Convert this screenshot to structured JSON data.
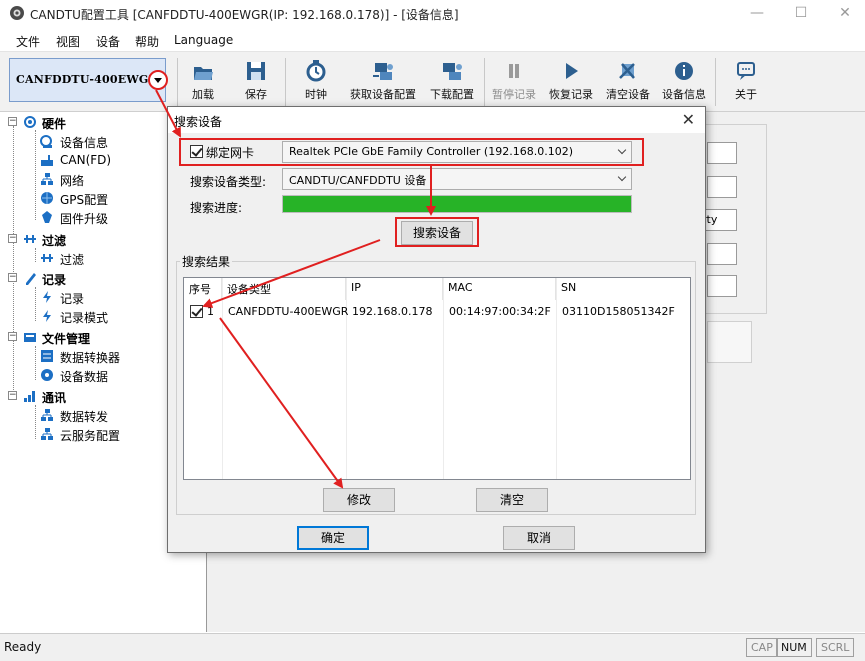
{
  "window": {
    "title": "CANDTU配置工具 [CANFDDTU-400EWGR(IP: 192.168.0.178)] - [设备信息]",
    "controls": [
      "—",
      "☐",
      "✕"
    ]
  },
  "menu": [
    "文件",
    "视图",
    "设备",
    "帮助",
    "Language"
  ],
  "toolbar": {
    "device_combo": "CANFDDTU-400EWGR",
    "buttons": [
      {
        "label": "加载",
        "icon": "load-icon"
      },
      {
        "label": "保存",
        "icon": "save-icon"
      },
      {
        "label": "时钟",
        "icon": "clock-icon"
      },
      {
        "label": "获取设备配置",
        "icon": "get-config-icon"
      },
      {
        "label": "下载配置",
        "icon": "download-config-icon"
      },
      {
        "label": "暂停记录",
        "icon": "pause-icon",
        "disabled": true
      },
      {
        "label": "恢复记录",
        "icon": "play-icon"
      },
      {
        "label": "清空设备",
        "icon": "clear-device-icon"
      },
      {
        "label": "设备信息",
        "icon": "info-icon"
      },
      {
        "label": "关于",
        "icon": "about-icon"
      }
    ]
  },
  "tree": {
    "groups": [
      {
        "label": "硬件",
        "icon": "hardware-icon",
        "children": [
          {
            "label": "设备信息",
            "icon": "device-info-icon"
          },
          {
            "label": "CAN(FD)",
            "icon": "can-icon"
          },
          {
            "label": "网络",
            "icon": "network-icon"
          },
          {
            "label": "GPS配置",
            "icon": "gps-icon"
          },
          {
            "label": "固件升级",
            "icon": "firmware-icon"
          }
        ]
      },
      {
        "label": "过滤",
        "icon": "filter-icon",
        "children": [
          {
            "label": "过滤",
            "icon": "filter-icon"
          }
        ]
      },
      {
        "label": "记录",
        "icon": "record-icon",
        "children": [
          {
            "label": "记录",
            "icon": "record-icon"
          },
          {
            "label": "记录模式",
            "icon": "record-mode-icon"
          }
        ]
      },
      {
        "label": "文件管理",
        "icon": "file-mgmt-icon",
        "children": [
          {
            "label": "数据转换器",
            "icon": "converter-icon"
          },
          {
            "label": "设备数据",
            "icon": "device-data-icon"
          }
        ]
      },
      {
        "label": "通讯",
        "icon": "comm-icon",
        "children": [
          {
            "label": "数据转发",
            "icon": "forward-icon"
          },
          {
            "label": "云服务配置",
            "icon": "cloud-icon"
          }
        ]
      }
    ]
  },
  "background_field_text": "rty",
  "dialog": {
    "title": "搜索设备",
    "bind_nic_label": "绑定网卡",
    "bind_nic_checked": true,
    "nic_value": "Realtek PCIe GbE Family Controller (192.168.0.102)",
    "device_type_label": "搜索设备类型:",
    "device_type_value": "CANDTU/CANFDDTU 设备",
    "progress_label": "搜索进度:",
    "progress_value": 1.0,
    "search_button": "搜索设备",
    "results_group": "搜索结果",
    "columns": [
      "序号",
      "设备类型",
      "IP",
      "MAC",
      "SN"
    ],
    "rows": [
      {
        "checked": true,
        "index": "1",
        "type": "CANFDDTU-400EWGR",
        "ip": "192.168.0.178",
        "mac": "00:14:97:00:34:2F",
        "sn": "03110D158051342F"
      }
    ],
    "modify_button": "修改",
    "clear_button": "清空",
    "ok_button": "确定",
    "cancel_button": "取消"
  },
  "status": {
    "text": "Ready",
    "indicators": [
      {
        "label": "CAP",
        "active": false
      },
      {
        "label": "NUM",
        "active": true
      },
      {
        "label": "SCRL",
        "active": false
      }
    ]
  },
  "colors": {
    "annotation_red": "#e02020",
    "progress_green": "#27b327",
    "combo_bg": "#dce7f7"
  }
}
